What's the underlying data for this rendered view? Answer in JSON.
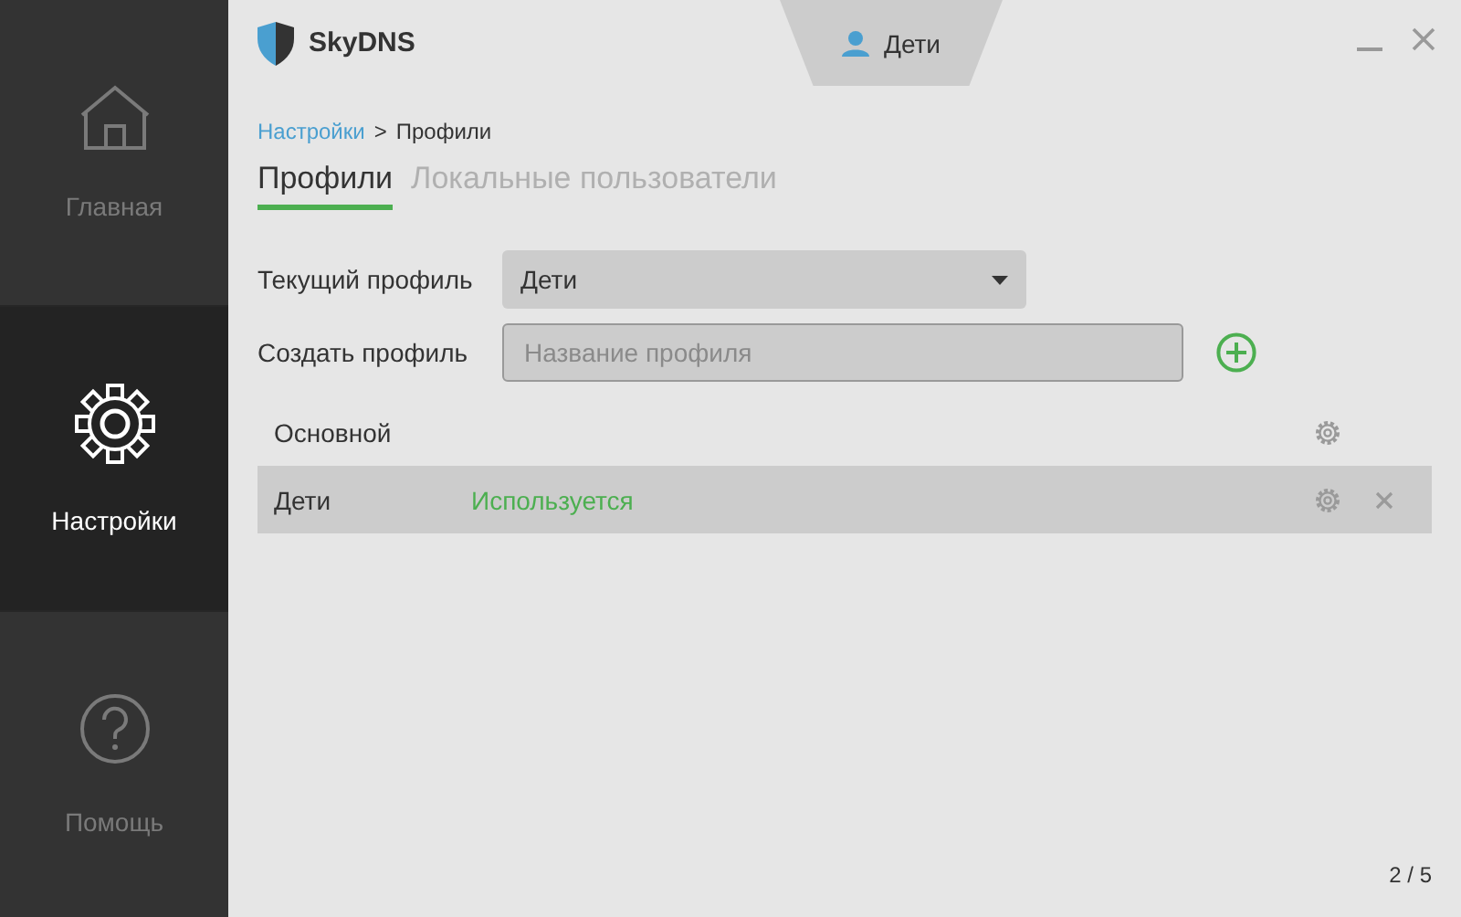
{
  "app": {
    "title": "SkyDNS"
  },
  "user_tab": {
    "label": "Дети"
  },
  "sidebar": {
    "items": [
      {
        "label": "Главная",
        "kind": "home",
        "selected": false
      },
      {
        "label": "Настройки",
        "kind": "settings",
        "selected": true
      },
      {
        "label": "Помощь",
        "kind": "help",
        "selected": false
      }
    ]
  },
  "breadcrumb": [
    {
      "label": "Настройки",
      "kind": "link"
    },
    {
      "label": ">",
      "kind": "separator"
    },
    {
      "label": "Профили",
      "kind": "current"
    }
  ],
  "tabs": [
    {
      "label": "Профили",
      "selected": true
    },
    {
      "label": "Локальные пользователи",
      "selected": false
    }
  ],
  "current_profile": {
    "label": "Текущий профиль",
    "value": "Дети"
  },
  "create_profile": {
    "label": "Создать профиль",
    "placeholder": "Название профиля"
  },
  "profiles": [
    {
      "name": "Основной",
      "selected": false,
      "removable": false
    },
    {
      "name": "Дети",
      "status": "Используется",
      "selected": true,
      "removable": true
    }
  ],
  "pager": "2 / 5"
}
